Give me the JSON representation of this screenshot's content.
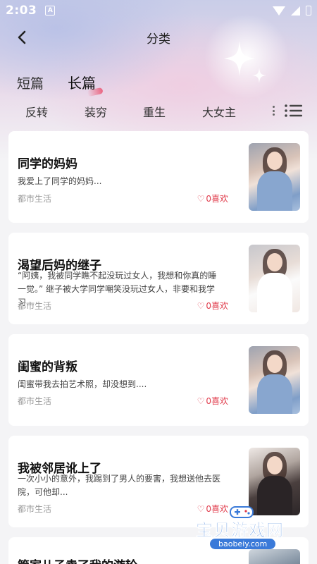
{
  "status_bar": {
    "time": "2:03",
    "notification_letter": "A"
  },
  "nav": {
    "title": "分类"
  },
  "main_tabs": [
    {
      "label": "短篇",
      "active": false
    },
    {
      "label": "长篇",
      "active": true
    }
  ],
  "sub_tabs": [
    "反转",
    "装穷",
    "重生",
    "大女主"
  ],
  "cards": [
    {
      "title": "同学的妈妈",
      "description": "我爱上了同学的妈妈...",
      "genre": "都市生活",
      "likes": "0喜欢"
    },
    {
      "title": "渴望后妈的继子",
      "description": "“阿姨，我被同学瞧不起没玩过女人，我想和你真的睡一觉。” 继子被大学同学嘲笑没玩过女人，非要和我学习…",
      "genre": "都市生活",
      "likes": "0喜欢"
    },
    {
      "title": "闺蜜的背叛",
      "description": "闺蜜带我去拍艺术照，却没想到....",
      "genre": "都市生活",
      "likes": "0喜欢"
    },
    {
      "title": "我被邻居讹上了",
      "description": "一次小小的意外，我踢到了男人的要害，我想送他去医院，可他却...",
      "genre": "都市生活",
      "likes": "0喜欢"
    },
    {
      "title": "管家儿子卖了我的游轮",
      "description": "",
      "genre": "",
      "likes": ""
    }
  ],
  "watermark": {
    "text": "宝贝游戏网",
    "url": "baobeiy.com"
  },
  "colors": {
    "like": "#e03a4a",
    "accent": "#eb506e",
    "card_bg": "#ffffff",
    "page_bg": "#f4f4f6"
  },
  "icons": {
    "back": "chevron-left-icon",
    "menu": "list-icon",
    "heart": "heart-outline-icon"
  }
}
